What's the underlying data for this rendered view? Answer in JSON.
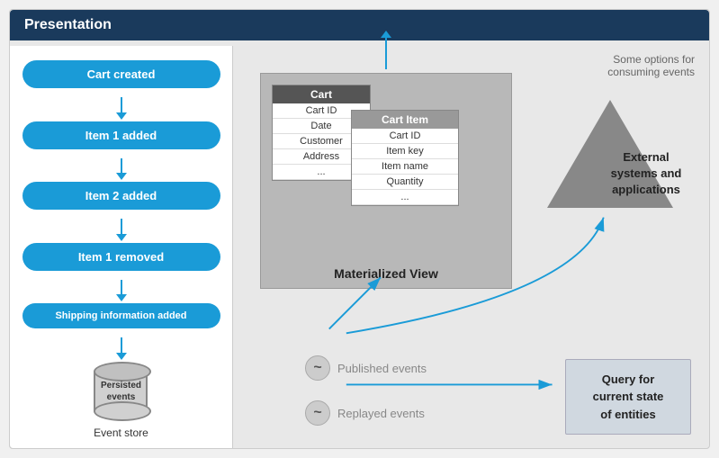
{
  "presentation": {
    "label": "Presentation"
  },
  "events": [
    {
      "id": "cart-created",
      "label": "Cart created"
    },
    {
      "id": "item1-added",
      "label": "Item 1 added"
    },
    {
      "id": "item2-added",
      "label": "Item 2 added"
    },
    {
      "id": "item1-removed",
      "label": "Item 1 removed"
    },
    {
      "id": "shipping-added",
      "label": "Shipping information added"
    }
  ],
  "event_store": {
    "cylinder_label": "Persisted\nevents",
    "store_label": "Event store"
  },
  "materialized_view": {
    "label": "Materialized View",
    "cart_table": {
      "header": "Cart",
      "rows": [
        "Cart ID",
        "Date",
        "Customer",
        "Address",
        "..."
      ]
    },
    "cart_item_table": {
      "header": "Cart Item",
      "rows": [
        "Cart ID",
        "Item key",
        "Item name",
        "Quantity",
        "..."
      ]
    }
  },
  "external_systems": {
    "label": "External\nsystems and\napplications"
  },
  "some_options": "Some options for\nconsuming events",
  "published_events": {
    "tilde": "~",
    "label": "Published events"
  },
  "replayed_events": {
    "tilde": "~",
    "label": "Replayed events"
  },
  "query_box": {
    "label": "Query for\ncurrent state\nof entities"
  }
}
